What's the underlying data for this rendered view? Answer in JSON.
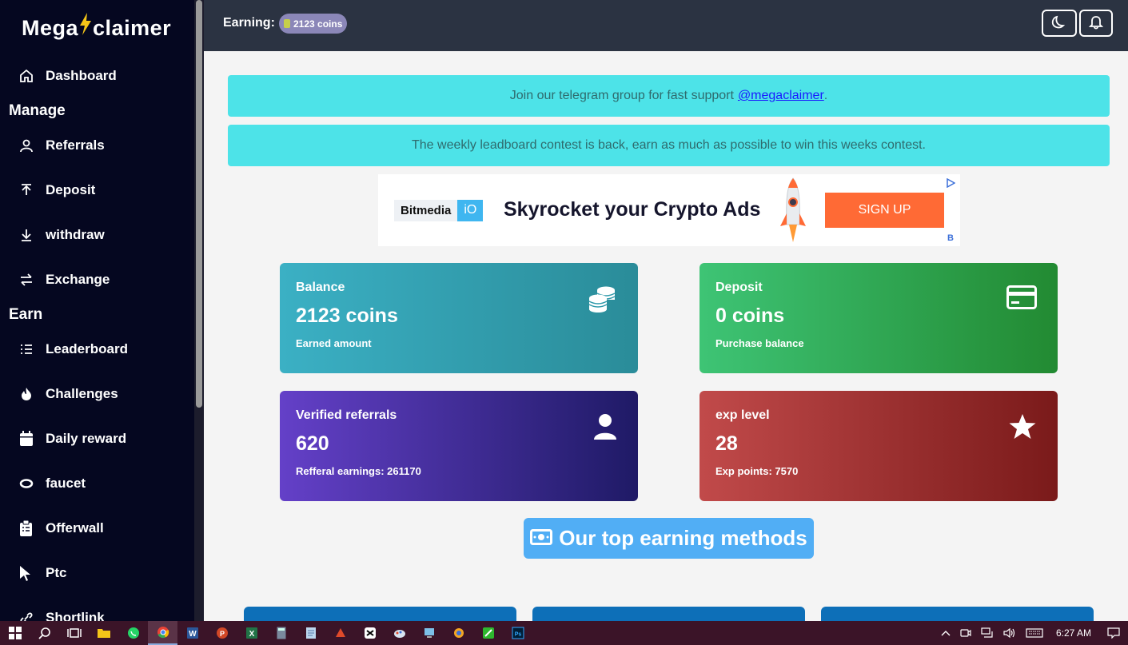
{
  "sidebar": {
    "logo_left": "Mega",
    "logo_right": "claimer",
    "dashboard": "Dashboard",
    "manage_head": "Manage",
    "referrals": "Referrals",
    "deposit": "Deposit",
    "withdraw": "withdraw",
    "exchange": "Exchange",
    "earn_head": "Earn",
    "leaderboard": "Leaderboard",
    "challenges": "Challenges",
    "daily_reward": "Daily reward",
    "faucet": "faucet",
    "offerwall": "Offerwall",
    "ptc": "Ptc",
    "shortlink": "Shortlink"
  },
  "header": {
    "earning_label": "Earning:",
    "earning_value": "2123 coins"
  },
  "alerts": {
    "telegram_text": "Join our telegram group for fast support",
    "telegram_link": "@megaclaimer",
    "telegram_end": ".",
    "contest_text": "The weekly leadboard contest is back, earn as much as possible to win this weeks contest."
  },
  "ad": {
    "brand": "Bitmedia",
    "brand_suffix": "iO",
    "headline": "Skyrocket your Crypto Ads",
    "cta": "SIGN UP"
  },
  "cards": {
    "balance": {
      "title": "Balance",
      "value": "2123 coins",
      "sub": "Earned amount",
      "colors": [
        "#3bb0c4",
        "#2a8c99"
      ]
    },
    "deposit": {
      "title": "Deposit",
      "value": "0 coins",
      "sub": "Purchase balance",
      "colors": [
        "#3ec475",
        "#228a32"
      ]
    },
    "referrals": {
      "title": "Verified referrals",
      "value": "620",
      "sub": "Refferal earnings: 261170",
      "colors": [
        "#6440c8",
        "#1f1a66"
      ]
    },
    "exp": {
      "title": "exp level",
      "value": "28",
      "sub": "Exp points: 7570",
      "colors": [
        "#c14a4a",
        "#7a1a1a"
      ]
    }
  },
  "methods": {
    "title": "Our top earning methods"
  },
  "taskbar": {
    "time": "6:27 AM"
  },
  "colors": {
    "sidebar_bg": "#050720",
    "topbar_bg": "#2b3342",
    "alert_bg": "#4de3e8",
    "accent_blue": "#51aef5",
    "ad_cta": "#ff6a35"
  }
}
